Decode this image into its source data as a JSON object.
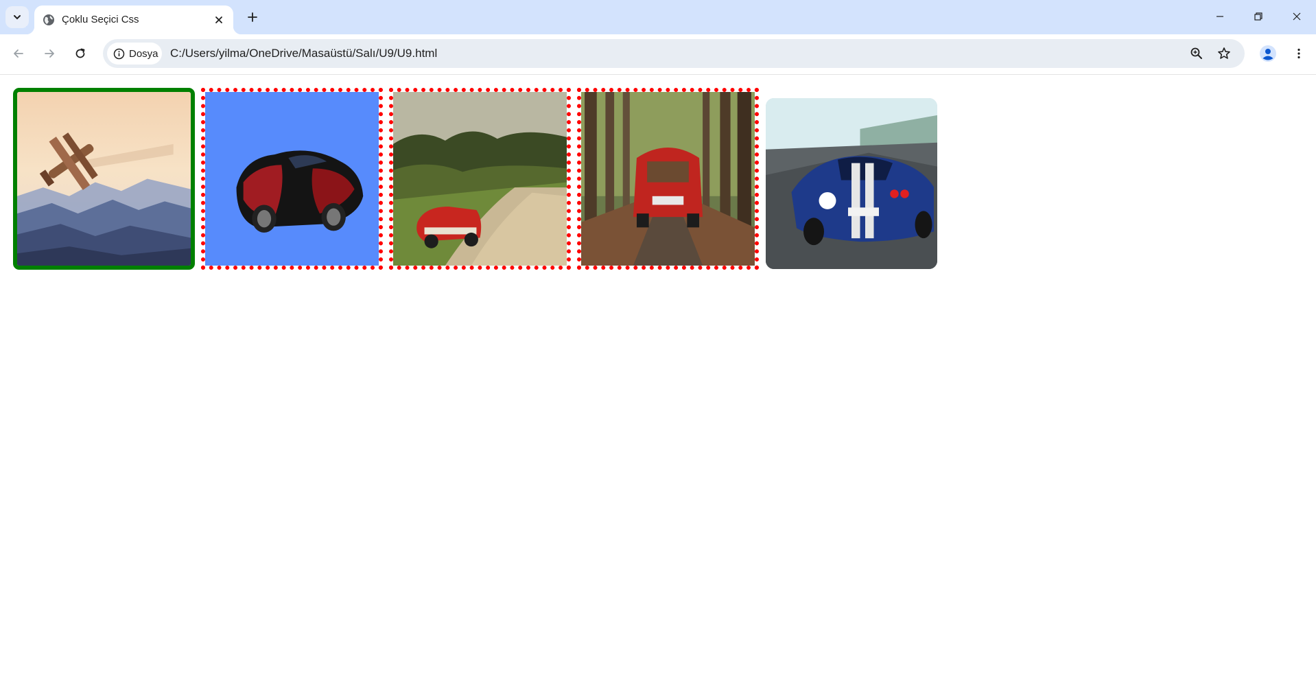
{
  "browser": {
    "tab": {
      "title": "Çoklu Seçici Css"
    },
    "address_bar": {
      "site_chip_label": "Dosya",
      "url": "C:/Users/yilma/OneDrive/Masaüstü/Salı/U9/U9.html"
    },
    "icons": {
      "tab_search": "chevron-down-icon",
      "favicon": "globe-icon",
      "close_tab": "close-icon",
      "new_tab": "plus-icon",
      "minimize": "minimize-icon",
      "restore": "restore-icon",
      "close_window": "close-icon",
      "back": "back-arrow-icon",
      "forward": "forward-arrow-icon",
      "reload": "reload-icon",
      "info": "info-icon",
      "zoom": "zoom-icon",
      "bookmark": "star-icon",
      "profile": "profile-icon",
      "menu": "kebab-menu-icon"
    }
  },
  "page": {
    "images": [
      {
        "subject": "biplane over misty mountains",
        "style": "solid-green-border",
        "border_color": "#008000"
      },
      {
        "subject": "red and black sports car on blue background",
        "style": "dotted-red-border",
        "border_color": "#ff0000"
      },
      {
        "subject": "red vintage convertible on dirt road",
        "style": "dotted-red-border",
        "border_color": "#ff0000"
      },
      {
        "subject": "small red car on forest road",
        "style": "dotted-red-border",
        "border_color": "#ff0000"
      },
      {
        "subject": "blue race car on track",
        "style": "rounded-no-border",
        "border_color": ""
      }
    ]
  },
  "colors": {
    "tabstrip_bg": "#d3e3fd",
    "omnibox_bg": "#e8edf3",
    "selected_border": "#008000",
    "dotted_border": "#ff0000"
  }
}
